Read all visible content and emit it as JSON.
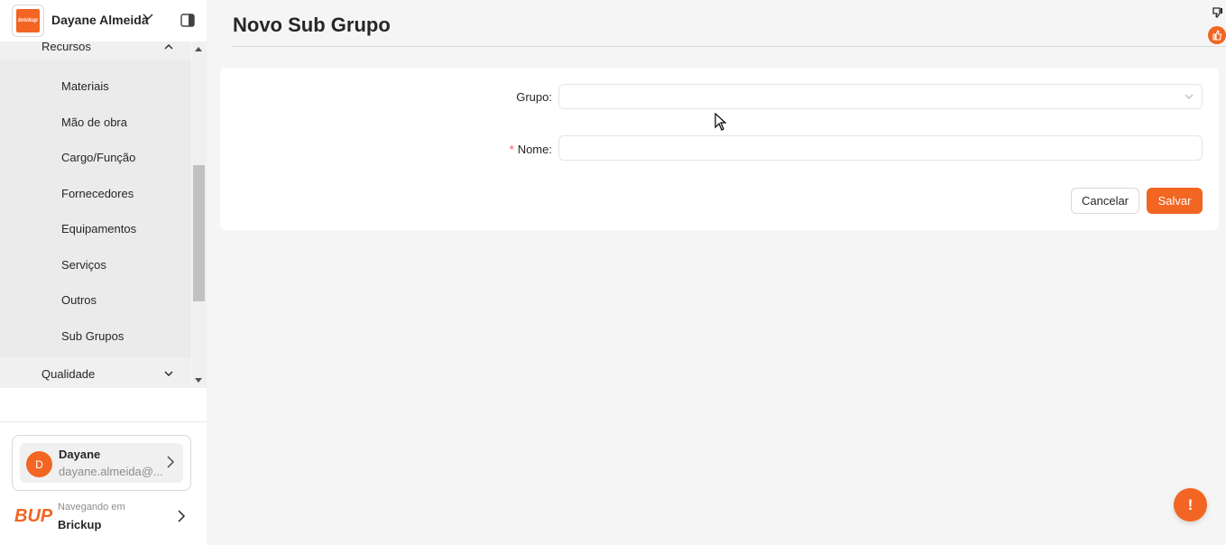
{
  "header": {
    "logo_text": "brickup",
    "user_name": "Dayane Almeida"
  },
  "menu": {
    "recursos_label": "Recursos",
    "sub_items": [
      "Materiais",
      "Mão de obra",
      "Cargo/Função",
      "Fornecedores",
      "Equipamentos",
      "Serviços",
      "Outros",
      "Sub Grupos"
    ],
    "qualidade_label": "Qualidade"
  },
  "user_card": {
    "avatar_letter": "D",
    "name": "Dayane",
    "email": "dayane.almeida@..."
  },
  "navigation": {
    "brand_logo": "BUP",
    "label": "Navegando em",
    "company": "Brickup"
  },
  "page": {
    "title": "Novo Sub Grupo"
  },
  "form": {
    "grupo_label": "Grupo",
    "nome_label": "Nome",
    "required_mark": "*",
    "cancel_label": "Cancelar",
    "save_label": "Salvar"
  },
  "fab": {
    "label": "!"
  },
  "colors": {
    "accent": "#f26522",
    "required": "#ff4d4f"
  }
}
